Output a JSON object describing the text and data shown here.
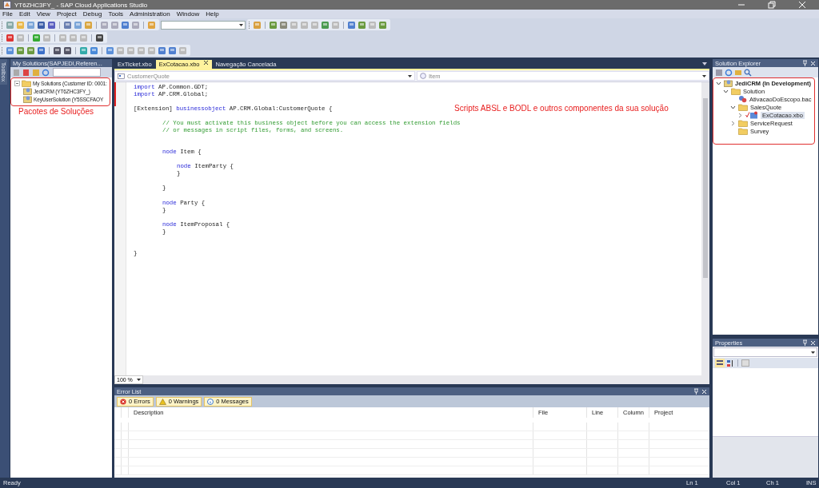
{
  "window": {
    "title": "YT6ZHC3FY_ - SAP Cloud Applications Studio"
  },
  "menu": [
    "File",
    "Edit",
    "View",
    "Project",
    "Debug",
    "Tools",
    "Administration",
    "Window",
    "Help"
  ],
  "toolbox": {
    "label": "Toolbox"
  },
  "my_solutions": {
    "title": "My Solutions(SAPJEDI,Referen...",
    "tree": [
      {
        "label": "My Solutions (Customer ID: 0001:",
        "expanded": true,
        "children": [
          {
            "label": "JediCRM (YT6ZHC3FY_)"
          },
          {
            "label": "KeyUserSolution (Y5SSCFAOY"
          }
        ]
      }
    ],
    "annotation": "Pacotes de Soluções"
  },
  "editor": {
    "tabs": [
      {
        "label": "ExTicket.xbo",
        "selected": false
      },
      {
        "label": "ExCotacao.xbo",
        "selected": true
      },
      {
        "label": "Navegação Cancelada",
        "selected": false
      }
    ],
    "type_dropdown": "CustomerQuote",
    "member_dropdown": "Item",
    "zoom": "100 %",
    "annotation": "Scripts ABSL e BODL e outros componentes da sua solução",
    "lines": [
      {
        "kind": "code",
        "tokens": [
          {
            "text": "import",
            "kind": "keyword"
          },
          {
            "text": " AP.Common.GDT;",
            "kind": "plain"
          }
        ]
      },
      {
        "kind": "code",
        "tokens": [
          {
            "text": "import",
            "kind": "keyword"
          },
          {
            "text": " AP.CRM.Global;",
            "kind": "plain"
          }
        ]
      },
      {
        "kind": "blank"
      },
      {
        "kind": "code",
        "tokens": [
          {
            "text": "[Extension] ",
            "kind": "plain"
          },
          {
            "text": "businessobject",
            "kind": "keyword"
          },
          {
            "text": " AP.CRM.Global:CustomerQuote {",
            "kind": "plain"
          }
        ],
        "children": [
          {
            "kind": "blank"
          },
          {
            "kind": "code",
            "tokens": [
              {
                "text": "// You must activate this business object before you can access the extension fields",
                "kind": "comment"
              }
            ]
          },
          {
            "kind": "code",
            "tokens": [
              {
                "text": "// or messages in script files, forms, and screens.",
                "kind": "comment"
              }
            ]
          },
          {
            "kind": "blank"
          },
          {
            "kind": "blank"
          },
          {
            "kind": "code",
            "tokens": [
              {
                "text": "node",
                "kind": "keyword"
              },
              {
                "text": " Item {",
                "kind": "plain"
              }
            ],
            "children": [
              {
                "kind": "blank"
              },
              {
                "kind": "code",
                "tokens": [
                  {
                    "text": "node",
                    "kind": "keyword"
                  },
                  {
                    "text": " ItemParty {",
                    "kind": "plain"
                  }
                ]
              },
              {
                "kind": "code",
                "tokens": [
                  {
                    "text": "}",
                    "kind": "plain"
                  }
                ]
              },
              {
                "kind": "blank"
              }
            ]
          },
          {
            "kind": "code",
            "tokens": [
              {
                "text": "}",
                "kind": "plain"
              }
            ]
          },
          {
            "kind": "blank"
          },
          {
            "kind": "code",
            "tokens": [
              {
                "text": "node",
                "kind": "keyword"
              },
              {
                "text": " Party {",
                "kind": "plain"
              }
            ]
          },
          {
            "kind": "code",
            "tokens": [
              {
                "text": "}",
                "kind": "plain"
              }
            ]
          },
          {
            "kind": "blank"
          },
          {
            "kind": "code",
            "tokens": [
              {
                "text": "node",
                "kind": "keyword"
              },
              {
                "text": " ItemProposal {",
                "kind": "plain"
              }
            ]
          },
          {
            "kind": "code",
            "tokens": [
              {
                "text": "}",
                "kind": "plain"
              }
            ]
          },
          {
            "kind": "blank"
          },
          {
            "kind": "blank"
          }
        ]
      },
      {
        "kind": "code",
        "tokens": [
          {
            "text": "}",
            "kind": "plain"
          }
        ]
      }
    ]
  },
  "error_list": {
    "title": "Error List",
    "filters": [
      {
        "label": "0 Errors",
        "kind": "error"
      },
      {
        "label": "0 Warnings",
        "kind": "warning"
      },
      {
        "label": "0 Messages",
        "kind": "info"
      }
    ],
    "columns": [
      "Description",
      "File",
      "Line",
      "Column",
      "Project"
    ]
  },
  "solution_explorer": {
    "title": "Solution Explorer",
    "tree": [
      {
        "label": "JediCRM (In Development)",
        "kind": "solution",
        "expanded": true,
        "selected": false,
        "children": [
          {
            "label": "Solution",
            "kind": "folder",
            "expanded": true,
            "selected": false,
            "children": [
              {
                "label": "AtivacaoDoEscopo.bac",
                "kind": "file",
                "selected": false
              },
              {
                "label": "SalesQuote",
                "kind": "folder",
                "expanded": true,
                "selected": false,
                "children": [
                  {
                    "label": "ExCotacao.xbo",
                    "kind": "object",
                    "expanded": false,
                    "selected": true
                  }
                ]
              },
              {
                "label": "ServiceRequest",
                "kind": "folder",
                "expanded": false,
                "selected": false
              },
              {
                "label": "Survey",
                "kind": "folder",
                "selected": false
              }
            ]
          }
        ]
      }
    ]
  },
  "properties": {
    "title": "Properties"
  },
  "status_bar": {
    "message": "Ready",
    "line": "Ln 1",
    "column": "Col 1",
    "char": "Ch 1",
    "mode": "INS"
  }
}
